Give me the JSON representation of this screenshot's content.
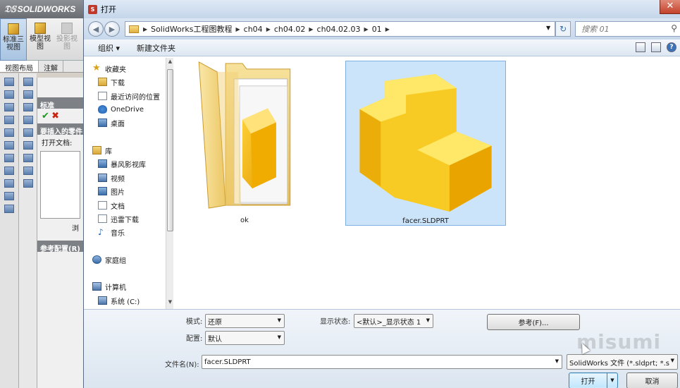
{
  "background_app": {
    "logo": "SOLIDWORKS",
    "toolbar": [
      {
        "label": "标准三视图",
        "active": true
      },
      {
        "label": "模型视图",
        "active": false
      },
      {
        "label": "投影视图",
        "active": false
      }
    ],
    "tabs": [
      "视图布局",
      "注解"
    ],
    "panel": {
      "header": "标准",
      "insert_section": "要插入的零件",
      "open_docs_label": "打开文档:",
      "browse_button": "浏",
      "ref_config": "参考配置(R)"
    }
  },
  "dialog": {
    "title": "打开",
    "close_glyph": "✕",
    "breadcrumb": [
      "SolidWorks工程图教程",
      "ch04",
      "ch04.02",
      "ch04.02.03",
      "01"
    ],
    "search_placeholder": "搜索 01",
    "commands": {
      "organize": "组织 ▾",
      "new_folder": "新建文件夹"
    },
    "nav": {
      "favorites": "收藏夹",
      "favorites_items": [
        "下载",
        "最近访问的位置",
        "OneDrive",
        "桌面"
      ],
      "library": "库",
      "library_items": [
        "暴风影视库",
        "视频",
        "图片",
        "文档",
        "迅雷下载",
        "音乐"
      ],
      "homegroup": "家庭组",
      "computer": "计算机",
      "computer_items": [
        "系统 (C:)"
      ]
    },
    "files": [
      {
        "name": "ok",
        "type": "folder",
        "selected": false
      },
      {
        "name": "facer.SLDPRT",
        "type": "sldprt",
        "selected": true
      }
    ],
    "options": {
      "mode_label": "模式:",
      "mode_value": "还原",
      "display_state_label": "显示状态:",
      "display_state_value": "<默认>_显示状态 1",
      "config_label": "配置:",
      "config_value": "默认",
      "reference_button": "参考(F)...",
      "filename_label": "文件名(N):",
      "filename_value": "facer.SLDPRT",
      "filetype_value": "SolidWorks 文件 (*.sldprt; *.s",
      "open_button": "打开",
      "cancel_button": "取消"
    }
  },
  "watermark": "misumi",
  "colors": {
    "selection": "#cce4fa",
    "title_bar": "#c5d6ea",
    "folder": "#f4d679",
    "part": "#f2b81b"
  }
}
